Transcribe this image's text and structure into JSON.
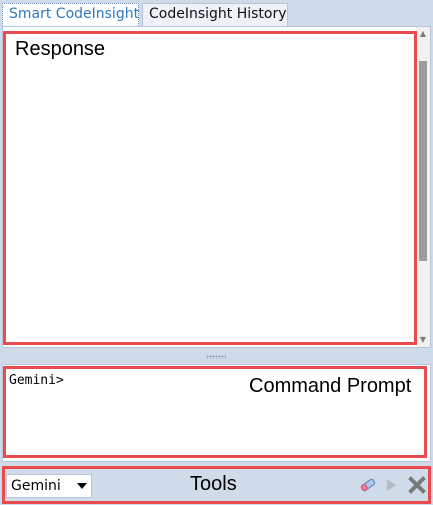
{
  "tabs": [
    {
      "label": "Smart CodeInsight",
      "active": true
    },
    {
      "label": "CodeInsight History",
      "active": false
    }
  ],
  "prompt": {
    "text": "Gemini>"
  },
  "toolbar": {
    "model_value": "Gemini",
    "eraser_icon": "eraser-icon",
    "run_icon": "play-icon",
    "stop_icon": "close-icon"
  },
  "annotations": {
    "response": "Response",
    "command_prompt": "Command Prompt",
    "tools": "Tools",
    "color": "#e94b4f"
  },
  "colors": {
    "background": "#cfdbe9",
    "active_tab_text": "#2f78c2"
  }
}
